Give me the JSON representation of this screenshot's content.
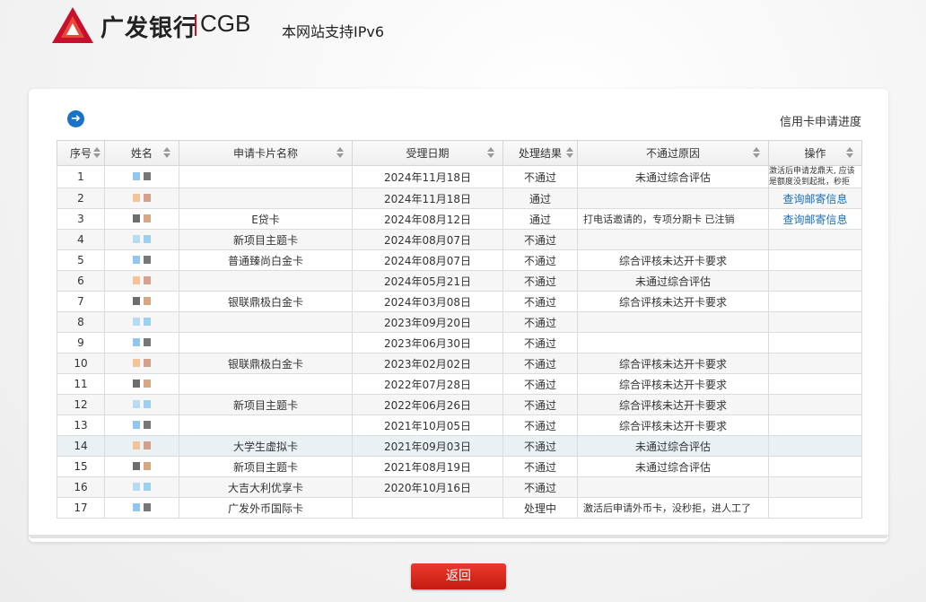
{
  "header": {
    "logo_cn": "广发银行",
    "logo_en": "CGB",
    "ipv6_notice": "本网站支持IPv6"
  },
  "page": {
    "title": "信用卡申请进度",
    "back_label": "返回"
  },
  "table": {
    "headers": [
      "序号",
      "姓名",
      "申请卡片名称",
      "受理日期",
      "处理结果",
      "不通过原因",
      "操作"
    ],
    "rows": [
      {
        "no": "1",
        "card": "",
        "date": "2024年11月18日",
        "result": "不通过",
        "reason": "未通过综合评估",
        "op": "激活后申请龙鼎天, 应该是额度没到起批，秒拒"
      },
      {
        "no": "2",
        "card": "",
        "date": "2024年11月18日",
        "result": "通过",
        "reason": "",
        "op": "查询邮寄信息"
      },
      {
        "no": "3",
        "card": "E贷卡",
        "date": "2024年08月12日",
        "result": "通过",
        "reason": "打电话邀请的，专项分期卡 已注销",
        "op": "查询邮寄信息"
      },
      {
        "no": "4",
        "card": "新项目主题卡",
        "date": "2024年08月07日",
        "result": "不通过",
        "reason": "",
        "op": ""
      },
      {
        "no": "5",
        "card": "普通臻尚白金卡",
        "date": "2024年08月07日",
        "result": "不通过",
        "reason": "综合评核未达开卡要求",
        "op": ""
      },
      {
        "no": "6",
        "card": "",
        "date": "2024年05月21日",
        "result": "不通过",
        "reason": "未通过综合评估",
        "op": ""
      },
      {
        "no": "7",
        "card": "银联鼎极白金卡",
        "date": "2024年03月08日",
        "result": "不通过",
        "reason": "综合评核未达开卡要求",
        "op": ""
      },
      {
        "no": "8",
        "card": "",
        "date": "2023年09月20日",
        "result": "不通过",
        "reason": "",
        "op": ""
      },
      {
        "no": "9",
        "card": "",
        "date": "2023年06月30日",
        "result": "不通过",
        "reason": "",
        "op": ""
      },
      {
        "no": "10",
        "card": "银联鼎极白金卡",
        "date": "2023年02月02日",
        "result": "不通过",
        "reason": "综合评核未达开卡要求",
        "op": ""
      },
      {
        "no": "11",
        "card": "",
        "date": "2022年07月28日",
        "result": "不通过",
        "reason": "综合评核未达开卡要求",
        "op": ""
      },
      {
        "no": "12",
        "card": "新项目主题卡",
        "date": "2022年06月26日",
        "result": "不通过",
        "reason": "综合评核未达开卡要求",
        "op": ""
      },
      {
        "no": "13",
        "card": "",
        "date": "2021年10月05日",
        "result": "不通过",
        "reason": "综合评核未达开卡要求",
        "op": ""
      },
      {
        "no": "14",
        "card": "大学生虚拟卡",
        "date": "2021年09月03日",
        "result": "不通过",
        "reason": "未通过综合评估",
        "op": ""
      },
      {
        "no": "15",
        "card": "新项目主题卡",
        "date": "2021年08月19日",
        "result": "不通过",
        "reason": "未通过综合评估",
        "op": ""
      },
      {
        "no": "16",
        "card": "大吉大利优享卡",
        "date": "2020年10月16日",
        "result": "不通过",
        "reason": "",
        "op": ""
      },
      {
        "no": "17",
        "card": "广发外币国际卡",
        "date": "",
        "result": "处理中",
        "reason": "激活后申请外币卡，没秒拒，进人工了",
        "op": ""
      }
    ]
  },
  "colors": {
    "brand_red": "#c8102e",
    "link_blue": "#1a6fb5",
    "annotation_red": "#d9261c"
  }
}
